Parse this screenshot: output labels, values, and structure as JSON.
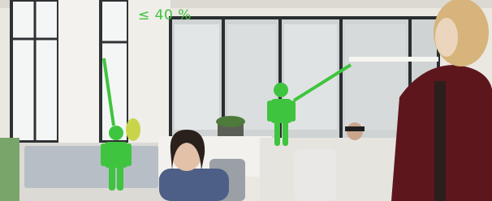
{
  "overlay": {
    "threshold_label": "≤ 40 %",
    "accent_color": "#3fc43f"
  },
  "scene": {
    "description_icons": [
      "person-figure-icon",
      "person-figure-icon"
    ],
    "colors": {
      "wall": "#eeece6",
      "window_frame": "#3a3d3f",
      "desk": "#f2f1ee",
      "partition": "#b9c1c9",
      "sweater": "#6b1a20",
      "hair": "#d6b27a"
    }
  }
}
